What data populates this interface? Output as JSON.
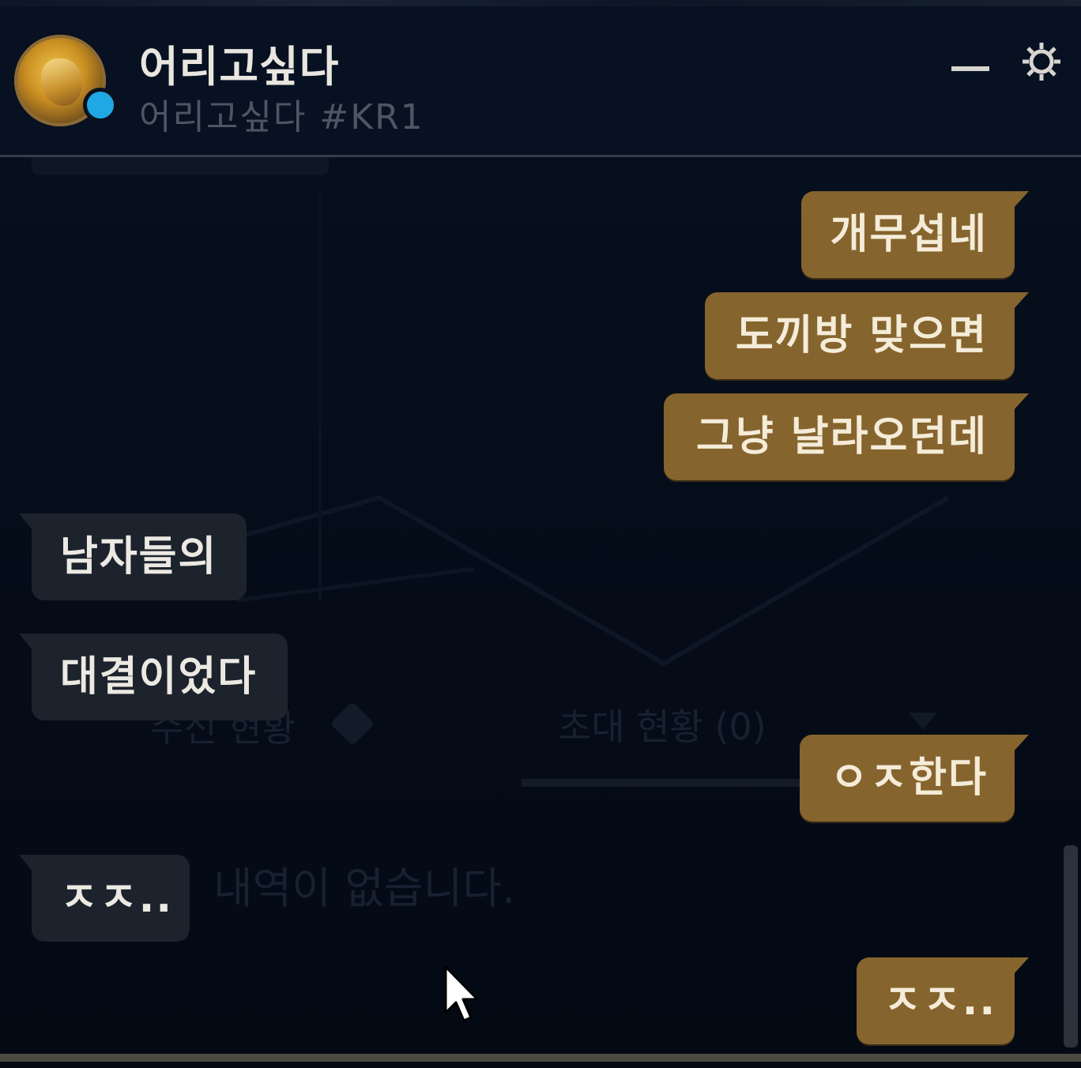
{
  "header": {
    "name": "어리고싶다",
    "tag": "어리고싶다 #KR1",
    "status_color": "#1fa8e4",
    "minimize_icon": "minimize-icon",
    "settings_icon": "gear-icon"
  },
  "background_panel": {
    "tab_left": "수신 현황",
    "tab_right": "초대 현황 (0)",
    "empty_message": "내역이 없습니다."
  },
  "messages": [
    {
      "side": "out",
      "text": "개무섭네"
    },
    {
      "side": "out",
      "text": "도끼방 맞으면"
    },
    {
      "side": "out",
      "text": "그냥 날라오던데"
    },
    {
      "side": "in",
      "text": "남자들의"
    },
    {
      "side": "in",
      "text": "대결이었다"
    },
    {
      "side": "out",
      "text": "ㅇㅈ한다"
    },
    {
      "side": "in",
      "text": "ㅈㅈ.."
    },
    {
      "side": "out",
      "text": "ㅈㅈ.."
    }
  ],
  "colors": {
    "outgoing_bubble": "#86642e",
    "incoming_bubble": "#1c232d",
    "background": "#050b16"
  }
}
